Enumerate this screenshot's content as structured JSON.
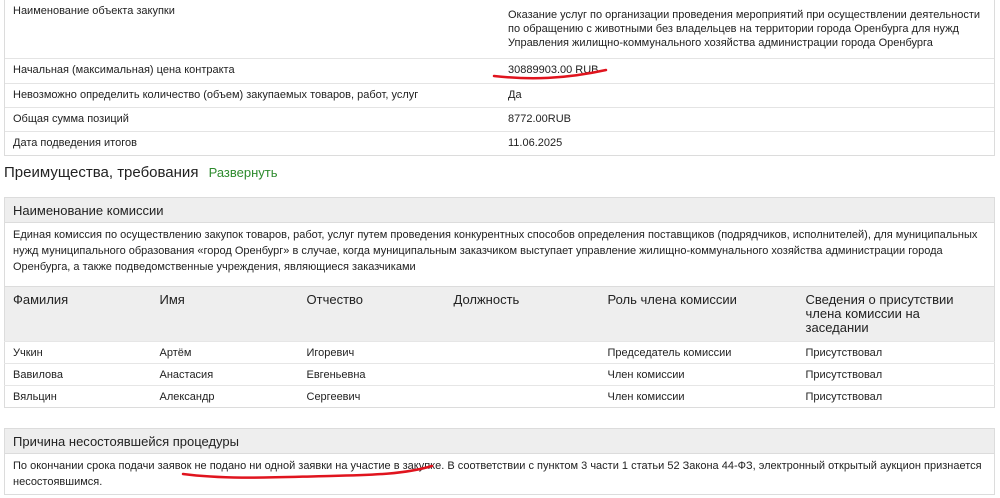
{
  "details": [
    {
      "label": "Наименование объекта закупки",
      "value": "Оказание услуг по организации проведения мероприятий при осуществлении деятельности по обращению с животными без владельцев на территории города Оренбурга для нужд Управления жилищно-коммунального хозяйства администрации города Оренбурга"
    },
    {
      "label": "Начальная (максимальная) цена контракта",
      "value": "30889903.00 RUB"
    },
    {
      "label": "Невозможно определить количество (объем) закупаемых товаров, работ, услуг",
      "value": "Да"
    },
    {
      "label": "Общая сумма позиций",
      "value": "8772.00RUB"
    },
    {
      "label": "Дата подведения итогов",
      "value": "11.06.2025"
    }
  ],
  "advantages": {
    "title": "Преимущества, требования",
    "expand_label": "Развернуть"
  },
  "commission": {
    "title": "Наименование комиссии",
    "text": "Единая комиссия по осуществлению закупок товаров, работ, услуг путем проведения конкурентных способов определения поставщиков (подрядчиков, исполнителей), для муниципальных нужд муниципального образования «город Оренбург» в случае, когда муниципальным заказчиком выступает управление жилищно-коммунального хозяйства администрации города Оренбурга, а также подведомственные учреждения, являющиеся заказчиками"
  },
  "members": {
    "headers": [
      "Фамилия",
      "Имя",
      "Отчество",
      "Должность",
      "Роль члена комиссии",
      "Сведения о присутствии члена комиссии на заседании"
    ],
    "rows": [
      [
        "Учкин",
        "Артём",
        "Игоревич",
        "",
        "Председатель комиссии",
        "Присутствовал"
      ],
      [
        "Вавилова",
        "Анастасия",
        "Евгеньевна",
        "",
        "Член комиссии",
        "Присутствовал"
      ],
      [
        "Вяльцин",
        "Александр",
        "Сергеевич",
        "",
        "Член комиссии",
        "Присутствовал"
      ]
    ]
  },
  "failure": {
    "title": "Причина несостоявшейся процедуры",
    "text": "По окончании срока подачи заявок не подано ни одной заявки на участие в закупке. В соответствии с пунктом 3 части 1 статьи 52 Закона 44-ФЗ, электронный открытый аукцион признается несостоявшимся."
  },
  "colors": {
    "accent_green": "#2e8b2e",
    "annotation_red": "#e0141e",
    "header_bg": "#eeeeee"
  }
}
